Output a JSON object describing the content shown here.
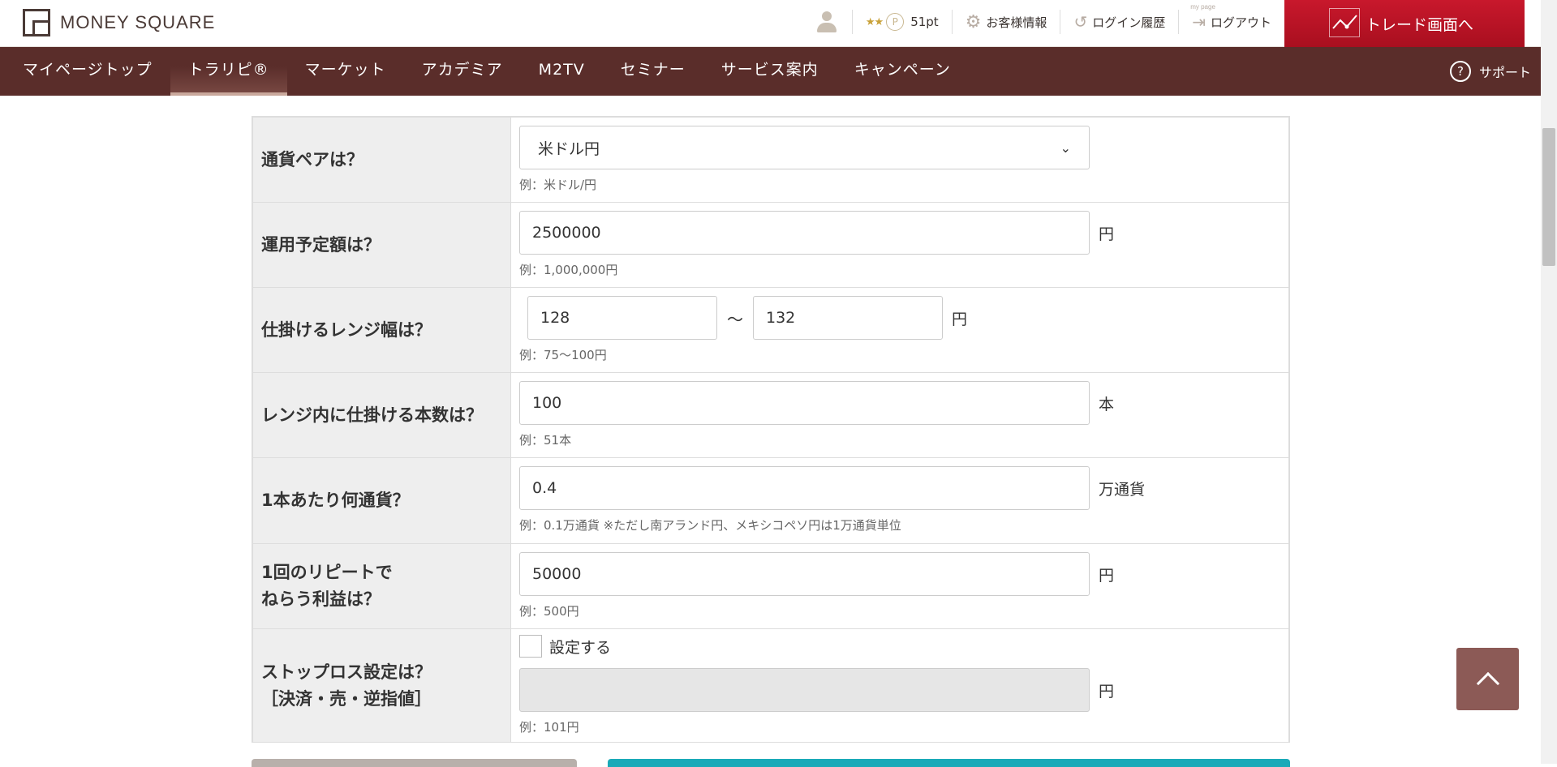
{
  "header": {
    "logo_text": "MONEY SQUARE",
    "stars": "★★",
    "points_icon_letter": "P",
    "points": "51pt",
    "customer_info": "お客様情報",
    "login_history": "ログイン履歴",
    "mypage_tag": "my page",
    "logout": "ログアウト",
    "trade_button": "トレード画面へ"
  },
  "nav": {
    "items": [
      {
        "label": "マイページトップ"
      },
      {
        "label": "トラリピ®"
      },
      {
        "label": "マーケット"
      },
      {
        "label": "アカデミア"
      },
      {
        "label": "M2TV"
      },
      {
        "label": "セミナー"
      },
      {
        "label": "サービス案内"
      },
      {
        "label": "キャンペーン"
      }
    ],
    "active_index": 1,
    "support": "サポート"
  },
  "form": {
    "currency_pair": {
      "label": "通貨ペアは？",
      "value": "米ドル円",
      "hint": "例：米ドル/円"
    },
    "budget": {
      "label": "運用予定額は？",
      "value": "2500000",
      "unit": "円",
      "hint": "例：1,000,000円"
    },
    "range": {
      "label": "仕掛けるレンジ幅は？",
      "from": "128",
      "separator": "〜",
      "to": "132",
      "unit": "円",
      "hint": "例：75〜100円"
    },
    "count": {
      "label": "レンジ内に仕掛ける本数は？",
      "value": "100",
      "unit": "本",
      "hint": "例：51本"
    },
    "per_trade": {
      "label": "1本あたり何通貨？",
      "value": "0.4",
      "unit": "万通貨",
      "hint": "例：0.1万通貨 ※ただし南アランド円、メキシコペソ円は1万通貨単位"
    },
    "profit": {
      "label_line1": "1回のリピートで",
      "label_line2": "ねらう利益は？",
      "value": "50000",
      "unit": "円",
      "hint": "例：500円"
    },
    "stoploss": {
      "label_line1": "ストップロス設定は？",
      "label_line2": "［決済・売・逆指値］",
      "checkbox_label": "設定する",
      "checked": false,
      "value": "",
      "unit": "円",
      "hint": "例：101円"
    }
  },
  "colors": {
    "nav_bg": "#5a2d2a",
    "trade_button": "#c8182c",
    "label_bg": "#eeeeee",
    "to_top": "#8c5a56",
    "teal_button": "#1aaab8"
  }
}
